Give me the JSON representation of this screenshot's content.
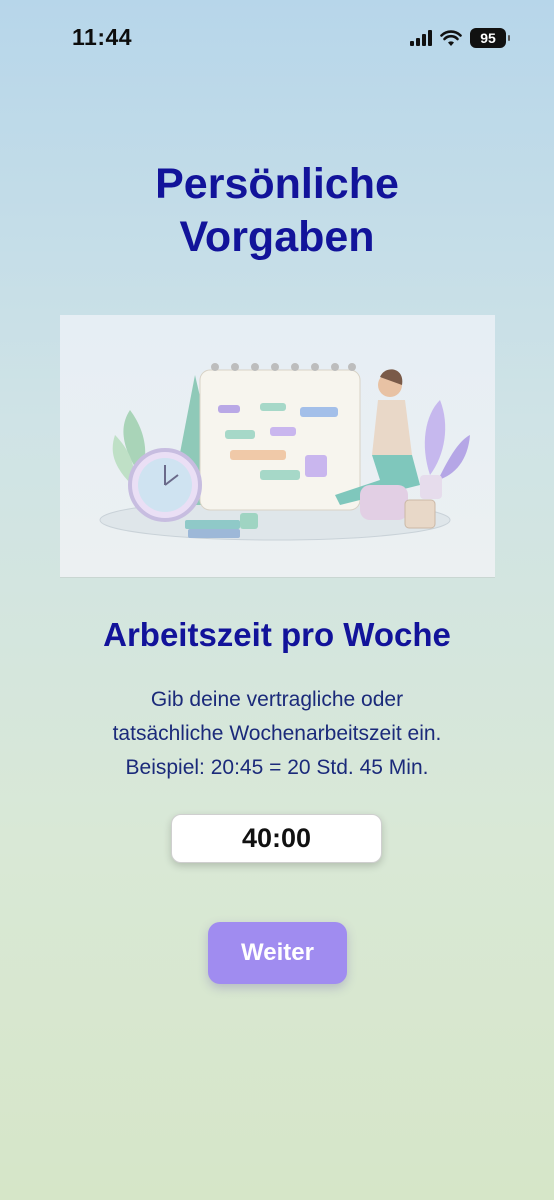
{
  "status_bar": {
    "time": "11:44",
    "battery": "95"
  },
  "header": {
    "title_line1": "Persönliche",
    "title_line2": "Vorgaben"
  },
  "section": {
    "title": "Arbeitszeit pro Woche",
    "description_line1": "Gib deine vertragliche oder",
    "description_line2": "tatsächliche Wochenarbeitszeit ein.",
    "description_line3": "Beispiel: 20:45 = 20 Std. 45 Min."
  },
  "hours_input": {
    "value": "40:00"
  },
  "next_button": {
    "label": "Weiter"
  },
  "colors": {
    "title": "#12139a",
    "button": "#a08cf0"
  }
}
